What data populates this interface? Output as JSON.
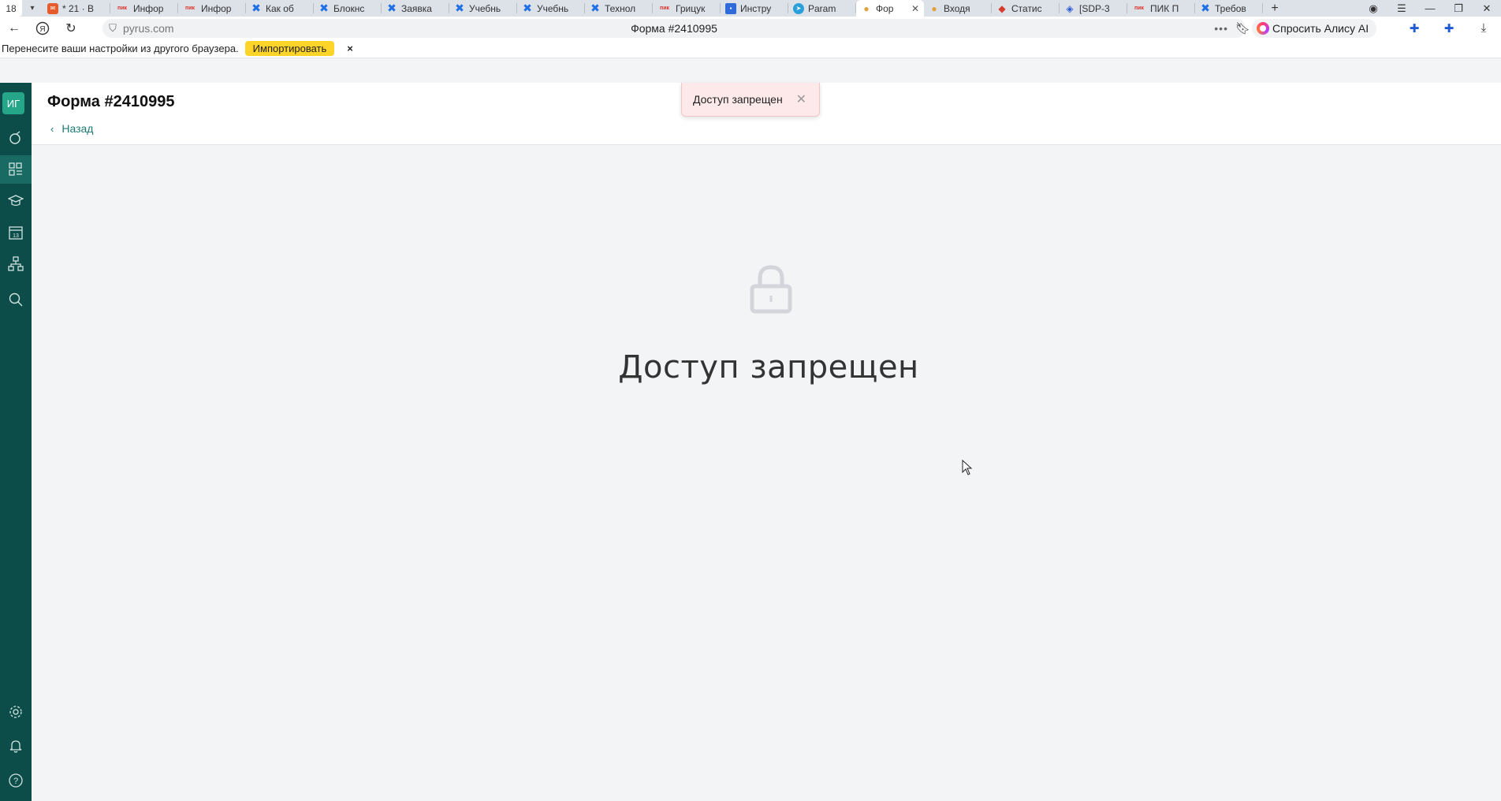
{
  "browser": {
    "tab_count": "18",
    "tabs": [
      {
        "label": "* 21 · В",
        "icon": "mail-icon",
        "glyph": "✉"
      },
      {
        "label": "Инфор",
        "icon": "pik-icon",
        "glyph": "пик"
      },
      {
        "label": "Инфор",
        "icon": "pik-icon",
        "glyph": "пик"
      },
      {
        "label": "Как об",
        "icon": "confluence-icon",
        "glyph": "✖"
      },
      {
        "label": "Блокнс",
        "icon": "confluence-icon",
        "glyph": "✖"
      },
      {
        "label": "Заявка",
        "icon": "confluence-icon",
        "glyph": "✖"
      },
      {
        "label": "Учебнь",
        "icon": "confluence-icon",
        "glyph": "✖"
      },
      {
        "label": "Учебнь",
        "icon": "confluence-icon",
        "glyph": "✖"
      },
      {
        "label": "Технол",
        "icon": "confluence-icon",
        "glyph": "✖"
      },
      {
        "label": "Грицук",
        "icon": "pik-icon",
        "glyph": "пик"
      },
      {
        "label": "Инстру",
        "icon": "doc-icon",
        "glyph": "▪"
      },
      {
        "label": "Param",
        "icon": "telegram-icon",
        "glyph": "➤"
      },
      {
        "label": "Фор",
        "icon": "pyrus-icon",
        "glyph": "●",
        "active": true
      },
      {
        "label": "Входя",
        "icon": "pyrus-icon",
        "glyph": "●"
      },
      {
        "label": "Статис",
        "icon": "stack-icon",
        "glyph": "◆"
      },
      {
        "label": "[SDP-3",
        "icon": "jira-icon",
        "glyph": "◈"
      },
      {
        "label": "ПИК П",
        "icon": "pik-icon",
        "glyph": "пик"
      },
      {
        "label": "Требов",
        "icon": "confluence-icon",
        "glyph": "✖"
      }
    ],
    "url_host": "pyrus.com",
    "page_title": "Форма #2410995",
    "alice_label": "Спросить Алису AI"
  },
  "infobar": {
    "message": "Перенесите ваши настройки из другого браузера.",
    "import_label": "Импортировать",
    "close_glyph": "×"
  },
  "sidebar": {
    "avatar_initials": "ИГ"
  },
  "header": {
    "title": "Форма #2410995",
    "back_label": "Назад"
  },
  "toast": {
    "message": "Доступ запрещен",
    "close_glyph": "✕"
  },
  "main": {
    "heading": "Доступ запрещен"
  },
  "colors": {
    "sidebar_bg": "#0d4d49",
    "accent": "#25a689",
    "link": "#1d7a72",
    "toast_bg": "#fde9ea",
    "import_button": "#ffd428"
  }
}
